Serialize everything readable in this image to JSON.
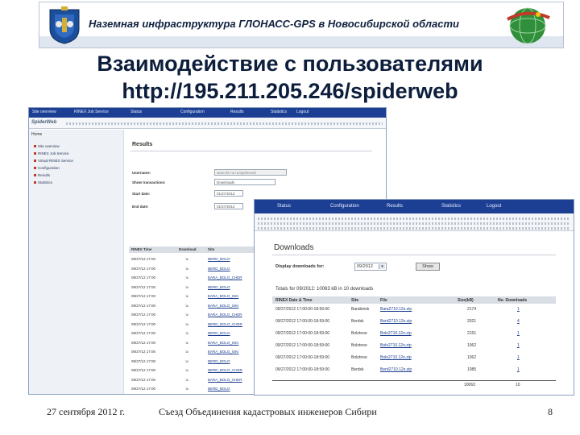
{
  "header": {
    "banner_text": "Наземная инфраструктура ГЛОНАСС-GPS  в Новосибирской области",
    "title_line1": "Взаимодействие с пользователями",
    "title_line2": "http://195.211.205.246/spiderweb"
  },
  "screenshot1": {
    "nav_items": [
      "Site overview",
      "RINEX Job Service",
      "Status",
      "Configuration",
      "Results",
      "Statistics",
      "Logout"
    ],
    "logo": "SpiderWeb",
    "sidebar": {
      "heading": "Home",
      "items": [
        "Site overview",
        "RINEX Job Service",
        "Virtual RINEX Service",
        "Configuration",
        "Results",
        "Statistics"
      ]
    },
    "results_heading": "Results",
    "form": {
      "user_label": "Username:",
      "user_value": "www.rtk-ns.ru/spiderweb",
      "show_label": "Show transactions:",
      "show_value": "Downloads",
      "start_label": "Start date:",
      "start_value": "01/27/2012",
      "end_label": "End date:",
      "end_value": "01/27/2012"
    },
    "table": {
      "columns": [
        "RINEX Time",
        "Download",
        "Site"
      ],
      "rows": [
        {
          "time": "09/27/12 17:00",
          "site": "BERD_BOLO"
        },
        {
          "time": "09/27/12 17:00",
          "site": "BERD_BOLO"
        },
        {
          "time": "09/27/12 17:00",
          "site": "BARA_BOLO_CHER"
        },
        {
          "time": "09/27/12 17:00",
          "site": "BERD_BOLO"
        },
        {
          "time": "09/27/12 17:00",
          "site": "BARA_BOLO_ISKI"
        },
        {
          "time": "09/27/12 17:00",
          "site": "BARA_BOLO_ISKI"
        },
        {
          "time": "09/27/12 17:00",
          "site": "BARA_BOLO_CHER"
        },
        {
          "time": "09/27/12 17:00",
          "site": "BERD_BOLO_CHER"
        },
        {
          "time": "09/27/12 17:00",
          "site": "BERD_BOLO"
        },
        {
          "time": "09/27/12 17:00",
          "site": "BARA_BOLO_ISKI"
        },
        {
          "time": "09/27/12 17:00",
          "site": "BARA_BOLO_ISKI"
        },
        {
          "time": "09/27/12 17:00",
          "site": "BERD_BOLO"
        },
        {
          "time": "09/27/12 17:00",
          "site": "BERD_BOLO_CHER"
        },
        {
          "time": "09/27/12 17:00",
          "site": "BARA_BOLO_CHER"
        },
        {
          "time": "09/27/12 17:00",
          "site": "BERD_BOLO"
        }
      ]
    }
  },
  "screenshot2": {
    "nav_items": [
      "Status",
      "Configuration",
      "Results",
      "Statistics",
      "Logout"
    ],
    "heading": "Downloads",
    "display_label": "Display downloads for:",
    "display_value": "09/2012",
    "show_button": "Show",
    "summary": "Totals for 09/2012: 10063 kB in 10 downloads",
    "table": {
      "columns": [
        "RINEX Date & Time",
        "Site",
        "File",
        "Size(kB)",
        "No. Downloads"
      ],
      "rows": [
        {
          "datetime": "09/27/2012 17:00:00-18:59:00",
          "site": "Barabinsk",
          "file": "Bara2710.12o.zip",
          "size": "2174",
          "downloads": "1"
        },
        {
          "datetime": "09/27/2012 17:00:00-18:59:00",
          "site": "Berdsk",
          "file": "Berd2710.12o.zip",
          "size": "2021",
          "downloads": "4"
        },
        {
          "datetime": "09/27/2012 17:00:00-18:59:00",
          "site": "Bolotnoe",
          "file": "Bolo2710.12o.zip",
          "size": "2151",
          "downloads": "1"
        },
        {
          "datetime": "09/27/2012 17:00:00-18:59:00",
          "site": "Bolotnoe",
          "file": "Bolo2710.12o.zip",
          "size": "1062",
          "downloads": "1"
        },
        {
          "datetime": "09/27/2012 17:00:00-18:59:00",
          "site": "Bolotnoe",
          "file": "Bolo2710.12o.zip",
          "size": "1062",
          "downloads": "1"
        },
        {
          "datetime": "09/27/2012 17:00:00-18:59:00",
          "site": "Berdsk",
          "file": "Berd2710.12o.zip",
          "size": "1085",
          "downloads": "1"
        }
      ],
      "total_size": "10063",
      "total_downloads": "10"
    }
  },
  "footer": {
    "date": "27 сентября 2012 г.",
    "center": "Съезд Объединения кадастровых инженеров Сибири",
    "page": "8"
  }
}
